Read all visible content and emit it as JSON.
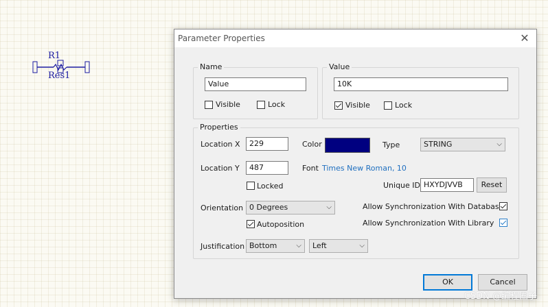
{
  "schematic": {
    "designator": "R1",
    "comment": "Res1"
  },
  "dialog": {
    "title": "Parameter Properties",
    "close_glyph": "✕",
    "name_group": {
      "label": "Name",
      "value": "Value",
      "visible_label": "Visible",
      "visible": false,
      "lock_label": "Lock",
      "lock": false
    },
    "value_group": {
      "label": "Value",
      "value": "10K",
      "visible_label": "Visible",
      "visible": true,
      "lock_label": "Lock",
      "lock": false
    },
    "properties": {
      "label": "Properties",
      "location_label": "Location",
      "x_label": "X",
      "x_value": "229",
      "y_label": "Y",
      "y_value": "487",
      "locked_label": "Locked",
      "locked": false,
      "color_label": "Color",
      "color": "#000080",
      "type_label": "Type",
      "type_value": "STRING",
      "font_label": "Font",
      "font_value": "Times New Roman, 10",
      "unique_id_label": "Unique ID",
      "unique_id": "HXYDJVVB",
      "reset_label": "Reset",
      "orientation_label": "Orientation",
      "orientation_value": "0 Degrees",
      "autoposition_label": "Autoposition",
      "autoposition": true,
      "sync_db_label": "Allow Synchronization With Database",
      "sync_db": true,
      "sync_lib_label": "Allow Synchronization With Library",
      "sync_lib": true,
      "justification_label": "Justification",
      "justification_v": "Bottom",
      "justification_h": "Left"
    },
    "ok_label": "OK",
    "cancel_label": "Cancel"
  },
  "watermark": "CSDN @编程圈子"
}
